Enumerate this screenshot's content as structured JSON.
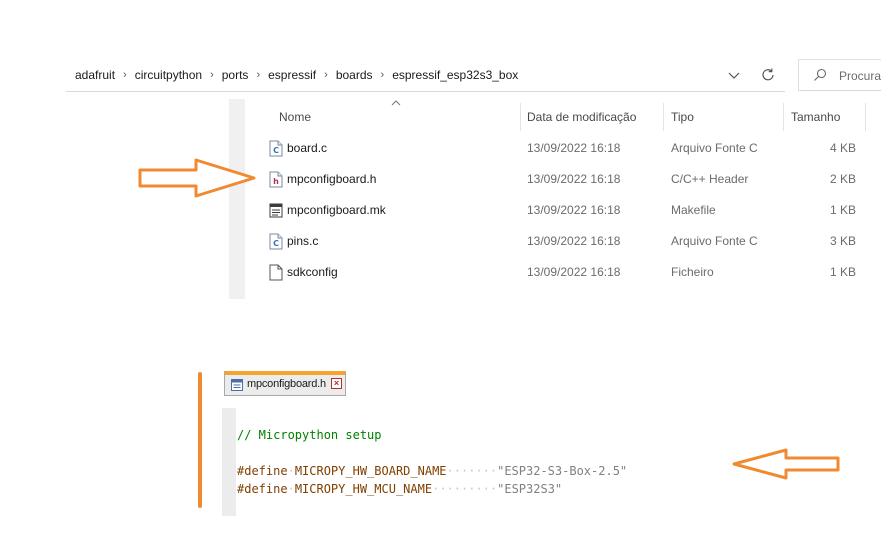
{
  "address_bar": {
    "breadcrumbs": [
      "adafruit",
      "circuitpython",
      "ports",
      "espressif",
      "boards",
      "espressif_esp32s3_box"
    ],
    "separator": "›"
  },
  "search": {
    "placeholder": "Procura"
  },
  "columns": {
    "name": "Nome",
    "date": "Data de modificação",
    "type": "Tipo",
    "size": "Tamanho"
  },
  "files": [
    {
      "name": "board.c",
      "date": "13/09/2022 16:18",
      "type": "Arquivo Fonte C",
      "size": "4 KB",
      "icon": "c-source-file-icon"
    },
    {
      "name": "mpconfigboard.h",
      "date": "13/09/2022 16:18",
      "type": "C/C++ Header",
      "size": "2 KB",
      "icon": "header-file-icon"
    },
    {
      "name": "mpconfigboard.mk",
      "date": "13/09/2022 16:18",
      "type": "Makefile",
      "size": "1 KB",
      "icon": "makefile-icon"
    },
    {
      "name": "pins.c",
      "date": "13/09/2022 16:18",
      "type": "Arquivo Fonte C",
      "size": "3 KB",
      "icon": "c-source-file-icon"
    },
    {
      "name": "sdkconfig",
      "date": "13/09/2022 16:18",
      "type": "Ficheiro",
      "size": "1 KB",
      "icon": "generic-file-icon"
    }
  ],
  "editor": {
    "tab_label": "mpconfigboard.h",
    "lines": {
      "comment": "// Micropython setup",
      "define1_kw": "#define",
      "define1_name": "MICROPY_HW_BOARD_NAME",
      "define1_value": "\"ESP32-S3-Box-2.5\"",
      "define2_kw": "#define",
      "define2_name": "MICROPY_HW_MCU_NAME",
      "define2_value": "\"ESP32S3\""
    }
  },
  "colors": {
    "annotation_orange": "#f08a30",
    "comment_green": "#008000",
    "preprocessor_brown": "#804000",
    "string_gray": "#808080"
  }
}
